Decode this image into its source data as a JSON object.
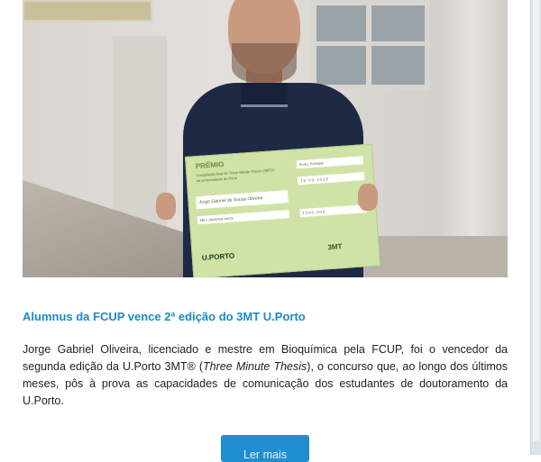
{
  "article": {
    "image_alt": "Jorge Gabriel Oliveira segurando o cheque do prémio 3MT U.Porto",
    "certificate": {
      "title": "PRÉMIO",
      "line1": "Competição final de Three Minute Thesis (3MT)®",
      "line2": "na Universidade do Porto",
      "place": "Porto, Portugal",
      "date": "1 6 · 0 3 · 2 0 2 3",
      "signature": "Jorge Gabriel de Sousa Oliveira",
      "amount_words": "Mil e duzentos euros",
      "amount": "1 2 0 0 , 0 0 €",
      "issuer_logo": "U.PORTO",
      "brand_logo": "3MT"
    },
    "headline": "Alumnus da FCUP vence 2ª edição do 3MT U.Porto",
    "body_part1": "Jorge Gabriel Oliveira, licenciado e mestre em Bioquímica pela FCUP, foi o vencedor da segunda edição da U.Porto 3MT® (",
    "body_italic": "Three Minute Thesis",
    "body_part2": "), o concurso que, ao longo dos últimos meses, pôs à prova as capacidades de comunicação dos estudantes de doutoramento da U.Porto.",
    "read_more_label": "Ler mais"
  },
  "colors": {
    "headline": "#1b8ac9",
    "button": "#1f8ed1",
    "certificate": "#cfe3a7"
  }
}
